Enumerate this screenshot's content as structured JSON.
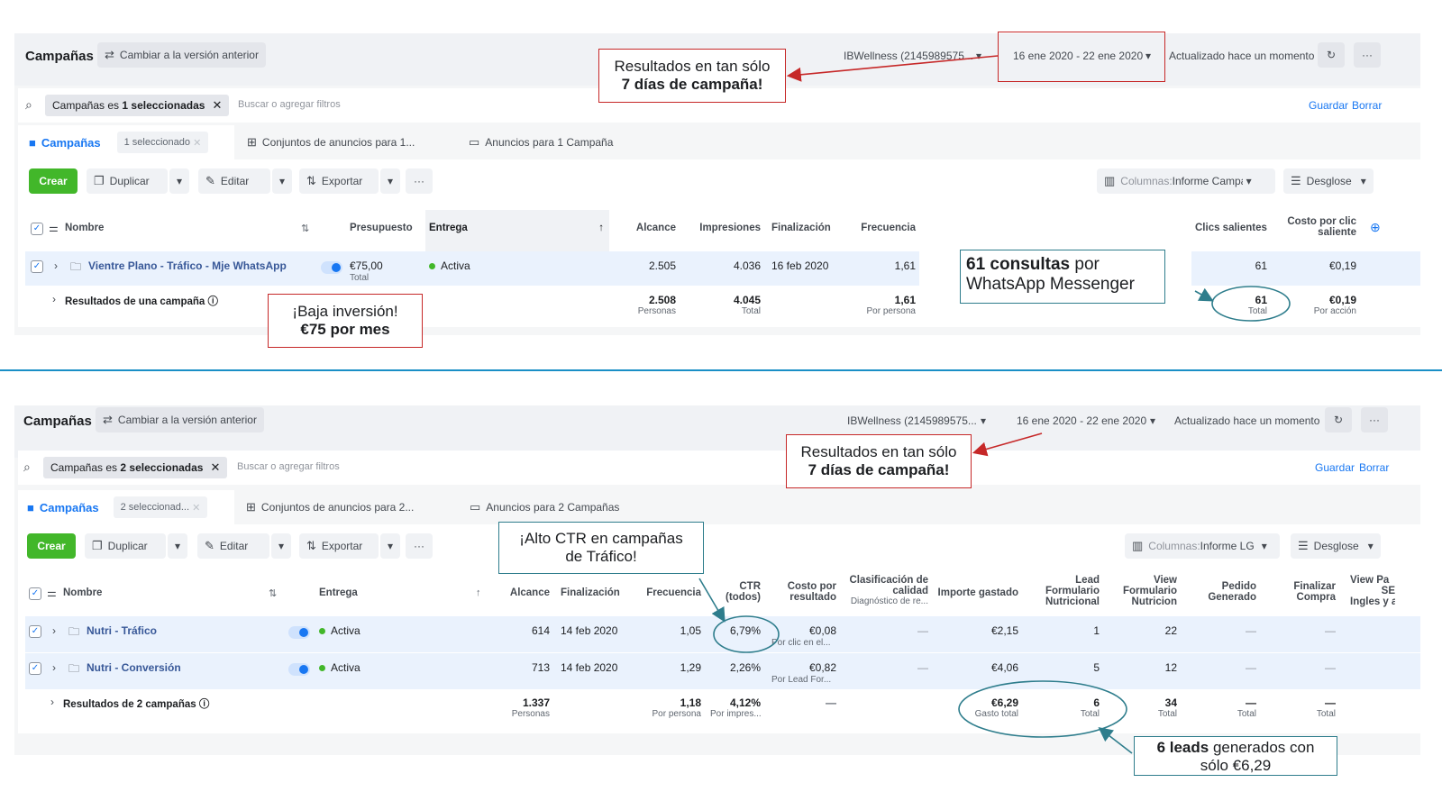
{
  "top": {
    "title": "Campañas",
    "switch_label": "Cambiar a la versión anterior",
    "account": "IBWellness (2145989575...",
    "date_range": "16 ene 2020 - 22 ene 2020",
    "updated": "Actualizado hace un momento",
    "filter_prefix": "Campañas es ",
    "filter_bold": "1 seleccionadas",
    "search_placeholder": "Buscar o agregar filtros",
    "guardar": "Guardar",
    "borrar": "Borrar",
    "tabs": {
      "campaigns": "Campañas",
      "selected": "1 seleccionado",
      "adsets": "Conjuntos de anuncios para 1...",
      "ads": "Anuncios para 1 Campaña"
    },
    "toolbar": {
      "crear": "Crear",
      "duplicar": "Duplicar",
      "editar": "Editar",
      "exportar": "Exportar",
      "more": "···",
      "columns_prefix": "Columnas: ",
      "columns": "Informe Campañ",
      "desglose": "Desglose"
    },
    "headers": {
      "nombre": "Nombre",
      "presupuesto": "Presupuesto",
      "entrega": "Entrega",
      "alcance": "Alcance",
      "impresiones": "Impresiones",
      "finalizacion": "Finalización",
      "frecuencia": "Frecuencia",
      "clics": "Clics salientes",
      "costo1": "Costo por clic",
      "costo2": "saliente"
    },
    "row": {
      "name": "Vientre Plano - Tráfico - Mje WhatsApp",
      "budget": "€75,00",
      "budget_sub": "Total",
      "status": "Activa",
      "reach": "2.505",
      "impressions": "4.036",
      "end": "16 feb 2020",
      "freq": "1,61",
      "clicks": "61",
      "cost": "€0,19"
    },
    "totals": {
      "label": "Resultados de una campaña",
      "reach": "2.508",
      "reach_sub": "Personas",
      "impressions": "4.045",
      "impressions_sub": "Total",
      "freq": "1,61",
      "freq_sub": "Por persona",
      "clicks": "61",
      "clicks_sub": "Total",
      "cost": "€0,19",
      "cost_sub": "Por acción"
    },
    "callouts": {
      "results_1": "Resultados en tan sólo",
      "results_2": "7 días de campaña!",
      "budget_1": "¡Baja inversión!",
      "budget_2": "€75 por mes",
      "whatsapp_bold": "61 consultas",
      "whatsapp_rest": " por",
      "whatsapp_2": "WhatsApp Messenger"
    }
  },
  "bottom": {
    "title": "Campañas",
    "switch_label": "Cambiar a la versión anterior",
    "account": "IBWellness (2145989575...",
    "date_range": "16 ene 2020 - 22 ene 2020",
    "updated": "Actualizado hace un momento",
    "filter_prefix": "Campañas es ",
    "filter_bold": "2 seleccionadas",
    "search_placeholder": "Buscar o agregar filtros",
    "guardar": "Guardar",
    "borrar": "Borrar",
    "tabs": {
      "campaigns": "Campañas",
      "selected": "2 seleccionad...",
      "adsets": "Conjuntos de anuncios para 2...",
      "ads": "Anuncios para 2 Campañas"
    },
    "toolbar": {
      "crear": "Crear",
      "duplicar": "Duplicar",
      "editar": "Editar",
      "exportar": "Exportar",
      "more": "···",
      "columns_prefix": "Columnas: ",
      "columns": "Informe LG",
      "desglose": "Desglose"
    },
    "headers": {
      "nombre": "Nombre",
      "entrega": "Entrega",
      "alcance": "Alcance",
      "finalizacion": "Finalización",
      "frecuencia": "Frecuencia",
      "ctr_1": "CTR",
      "ctr_2": "(todos)",
      "costo_1": "Costo por",
      "costo_2": "resultado",
      "calidad_1": "Clasificación de",
      "calidad_2": "calidad",
      "calidad_3": "Diagnóstico de re...",
      "importe": "Importe gastado",
      "lead_1": "Lead",
      "lead_2": "Formulario",
      "lead_3": "Nutricional",
      "view_1": "View",
      "view_2": "Formulario",
      "view_3": "Nutricion",
      "pedido_1": "Pedido",
      "pedido_2": "Generado",
      "finalizar_1": "Finalizar",
      "finalizar_2": "Compra",
      "viewp_1": "View Pa",
      "viewp_2": "SE",
      "viewp_3": "Ingles y a"
    },
    "rows": [
      {
        "name": "Nutri - Tráfico",
        "status": "Activa",
        "reach": "614",
        "end": "14 feb 2020",
        "freq": "1,05",
        "ctr": "6,79%",
        "cost": "€0,08",
        "cost_sub": "Por clic en el...",
        "quality": "—",
        "spent": "€2,15",
        "lead": "1",
        "view": "22",
        "pedido": "—",
        "finalizar": "—"
      },
      {
        "name": "Nutri - Conversión",
        "status": "Activa",
        "reach": "713",
        "end": "14 feb 2020",
        "freq": "1,29",
        "ctr": "2,26%",
        "cost": "€0,82",
        "cost_sub": "Por Lead For...",
        "quality": "—",
        "spent": "€4,06",
        "lead": "5",
        "view": "12",
        "pedido": "—",
        "finalizar": "—"
      }
    ],
    "totals": {
      "label": "Resultados de 2 campañas",
      "reach": "1.337",
      "reach_sub": "Personas",
      "freq": "1,18",
      "freq_sub": "Por persona",
      "ctr": "4,12%",
      "ctr_sub": "Por impres...",
      "cost": "—",
      "spent": "€6,29",
      "spent_sub": "Gasto total",
      "lead": "6",
      "lead_sub": "Total",
      "view": "34",
      "view_sub": "Total",
      "pedido": "—",
      "pedido_sub": "Total",
      "finalizar": "—",
      "finalizar_sub": "Total"
    },
    "callouts": {
      "results_1": "Resultados en tan sólo",
      "results_2": "7 días de campaña!",
      "ctr_1": "¡Alto CTR en campañas",
      "ctr_2": "de Tráfico!",
      "leads_bold": "6 leads",
      "leads_rest": " generados con",
      "leads_2": "sólo €6,29"
    }
  },
  "colors": {
    "accent": "#1877f2",
    "red_callout": "#c62828",
    "teal_callout": "#2e7d8c",
    "divider": "#1a8fc6",
    "active": "#42b72a"
  }
}
